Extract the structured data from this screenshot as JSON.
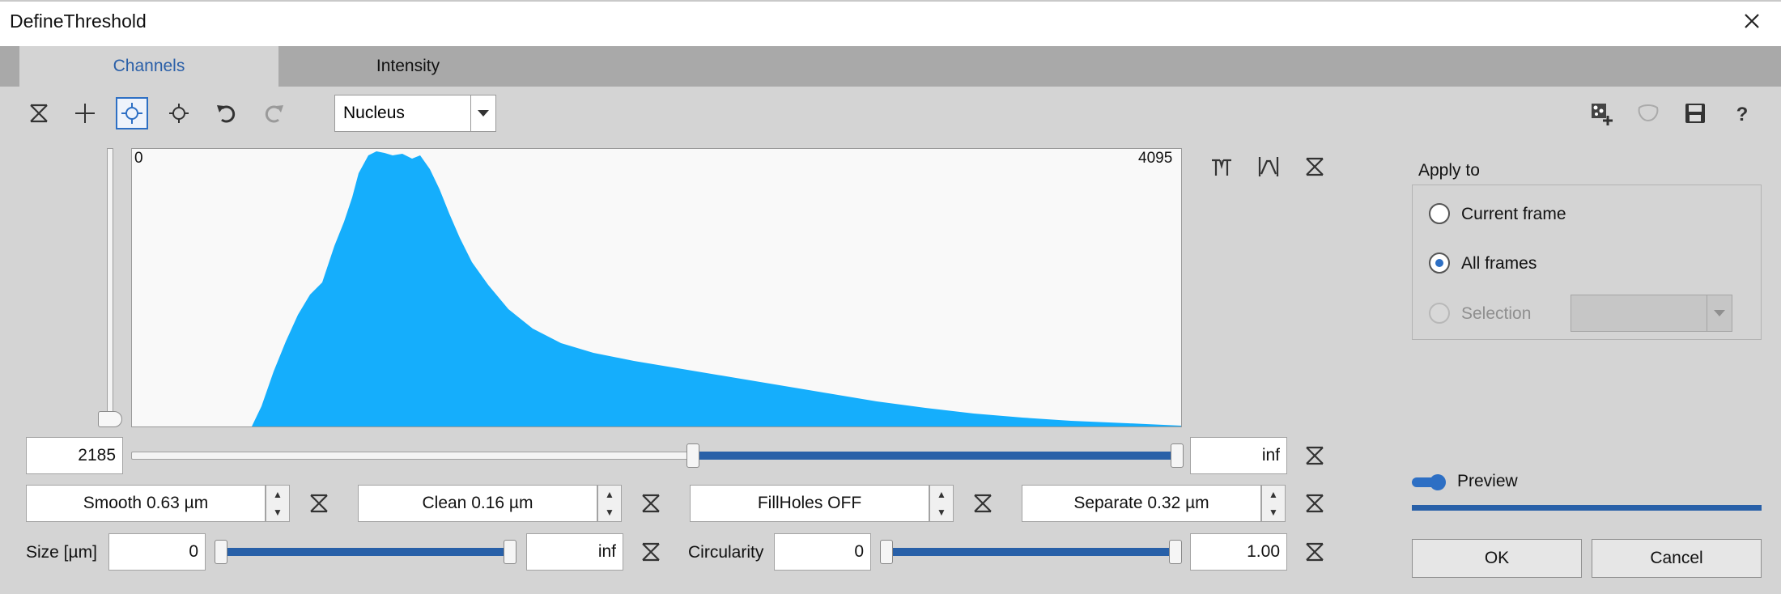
{
  "window": {
    "title": "DefineThreshold"
  },
  "tabs": [
    {
      "label": "Channels"
    },
    {
      "label": "Intensity"
    }
  ],
  "toolbar": {
    "channel": "Nucleus",
    "icons": [
      "reset-icon",
      "crosshair-icon",
      "auto-threshold-icon",
      "sun-threshold-icon",
      "undo-icon",
      "redo-icon"
    ],
    "right_icons": [
      "add-region-icon",
      "object-icon",
      "save-icon",
      "help-icon"
    ]
  },
  "histogram": {
    "min_label": "0",
    "max_label": "4095",
    "color": "#15aefc",
    "side_icons": [
      "fit-to-range-icon",
      "peak-icon",
      "reset-icon"
    ]
  },
  "threshold": {
    "low": "2185",
    "high": "inf",
    "range_fraction": [
      0.535,
      0.995
    ]
  },
  "filters": {
    "smooth": "Smooth 0.63 µm",
    "clean": "Clean 0.16 µm",
    "fillholes": "FillHoles OFF",
    "separate": "Separate 0.32 µm"
  },
  "size": {
    "label": "Size [µm]",
    "min": "0",
    "max": "inf"
  },
  "circularity": {
    "label": "Circularity",
    "min": "0",
    "max": "1.00"
  },
  "apply_to": {
    "title": "Apply to",
    "options": [
      {
        "label": "Current frame",
        "checked": false,
        "disabled": false
      },
      {
        "label": "All frames",
        "checked": true,
        "disabled": false
      },
      {
        "label": "Selection",
        "checked": false,
        "disabled": true
      }
    ]
  },
  "preview": {
    "label": "Preview",
    "on": true
  },
  "buttons": {
    "ok": "OK",
    "cancel": "Cancel"
  },
  "colors": {
    "accent": "#2d6fc4",
    "slider_fill": "#2860a8",
    "histogram": "#15aefc"
  }
}
